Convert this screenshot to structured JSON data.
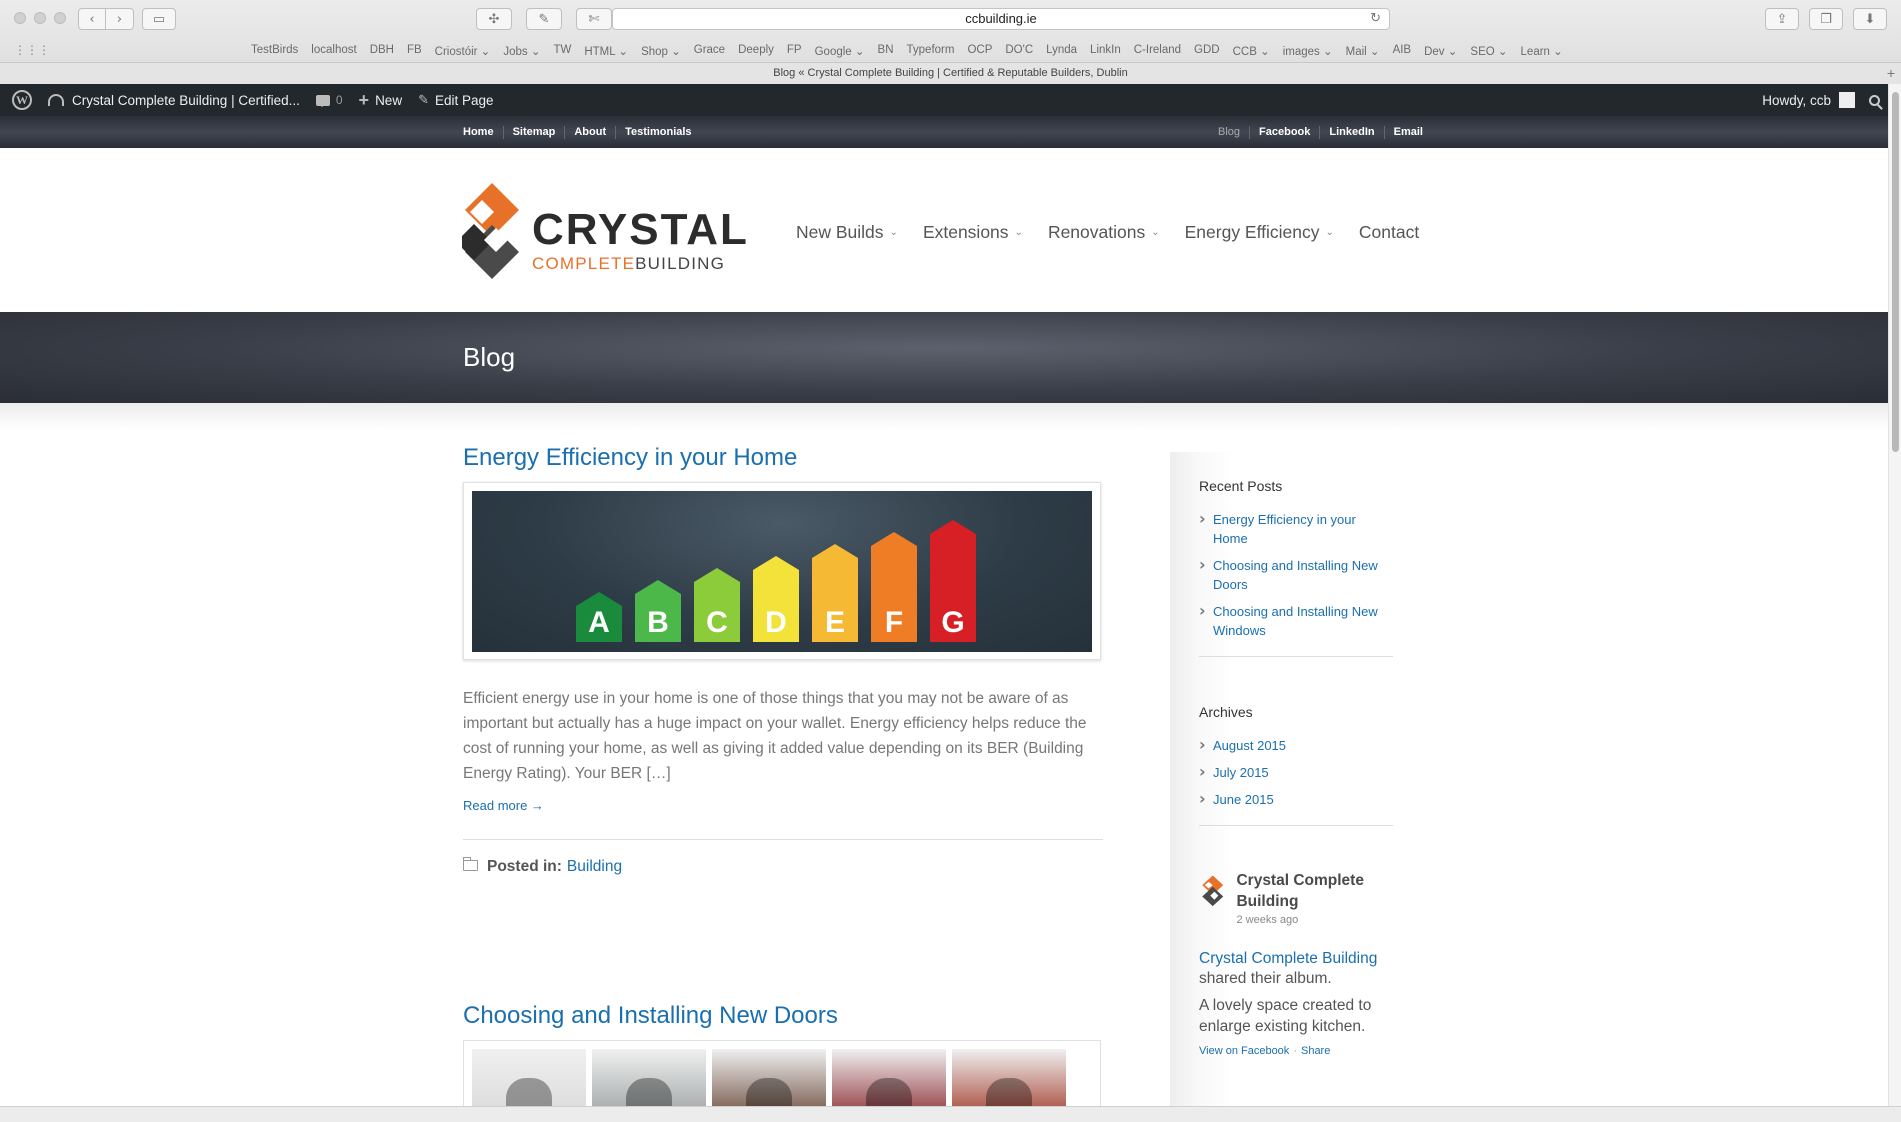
{
  "browser": {
    "url": "ccbuilding.ie",
    "tab_title": "Blog « Crystal Complete Building | Certified & Reputable Builders, Dublin",
    "bookmarks": [
      "TestBirds",
      "localhost",
      "DBH",
      "FB",
      "Criostóir ⌄",
      "Jobs ⌄",
      "TW",
      "HTML ⌄",
      "Shop ⌄",
      "Grace",
      "Deeply",
      "FP",
      "Google ⌄",
      "BN",
      "Typeform",
      "OCP",
      "DO'C",
      "Lynda",
      "LinkIn",
      "C-Ireland",
      "GDD",
      "CCB ⌄",
      "images ⌄",
      "Mail ⌄",
      "AIB",
      "Dev ⌄",
      "SEO ⌄",
      "Learn ⌄"
    ]
  },
  "adminbar": {
    "site_name": "Crystal Complete Building | Certified...",
    "comments_count": "0",
    "new_label": "New",
    "edit_label": "Edit Page",
    "howdy": "Howdy, ccb"
  },
  "toplinks": {
    "left": [
      "Home",
      "Sitemap",
      "About",
      "Testimonials"
    ],
    "right": [
      "Blog",
      "Facebook",
      "LinkedIn",
      "Email"
    ]
  },
  "logo": {
    "word": "CRYSTAL",
    "sub_orange": "COMPLETE",
    "sub_dark": "BUILDING"
  },
  "nav": [
    "New Builds",
    "Extensions",
    "Renovations",
    "Energy Efficiency",
    "Contact"
  ],
  "page_title": "Blog",
  "posts": [
    {
      "title": "Energy Efficiency in your Home",
      "excerpt": "Efficient energy use in your home is one of those things that you may not be aware of as important but actually has a huge impact on your wallet. Energy efficiency helps reduce the cost of running your home, as well as giving it added value depending on its BER (Building Energy Rating). Your BER […]",
      "read_more": "Read more →",
      "posted_in_label": "Posted in:",
      "category": "Building",
      "energy_letters": [
        "A",
        "B",
        "C",
        "D",
        "E",
        "F",
        "G"
      ],
      "energy_colors": [
        "#1a8a3c",
        "#4cb84a",
        "#8ccc3a",
        "#f2e23a",
        "#f6b934",
        "#ef7d25",
        "#d71f26"
      ]
    },
    {
      "title": "Choosing and Installing New Doors",
      "door_colors": [
        "#d9d9d9",
        "#9aa0a0",
        "#6a4a3a",
        "#8a2a30",
        "#a03a2a"
      ]
    }
  ],
  "sidebar": {
    "recent_title": "Recent Posts",
    "recent": [
      "Energy Efficiency in your Home",
      "Choosing and Installing New Doors",
      "Choosing and Installing New Windows"
    ],
    "archives_title": "Archives",
    "archives": [
      "August 2015",
      "July 2015",
      "June 2015"
    ],
    "fb": {
      "name": "Crystal Complete Building",
      "time": "2 weeks ago",
      "link": "Crystal Complete Building",
      "shared": "shared their album.",
      "text": "A lovely space created to enlarge existing kitchen.",
      "view": "View on Facebook",
      "share": "Share"
    }
  },
  "colors": {
    "accent": "#1a6fb0",
    "orange": "#e8712a",
    "dark": "#23282d"
  }
}
